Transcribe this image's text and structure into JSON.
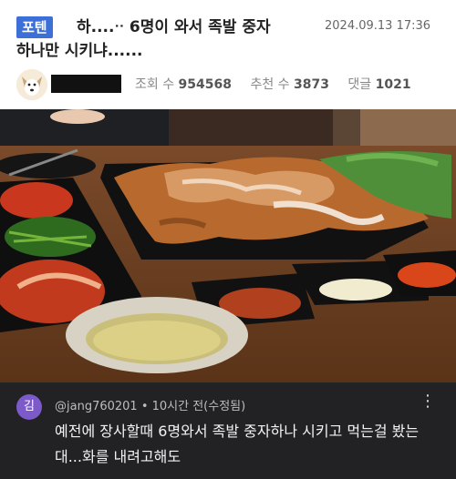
{
  "post": {
    "category_badge": "포텐",
    "title_line1": "하....ᐧᐧ 6명이 와서 족발 중자",
    "title_line2": "하나만 시키냐......",
    "date": "2024.09.13 17:36",
    "stats": {
      "views_label": "조회 수",
      "views": "954568",
      "votes_label": "추천 수",
      "votes": "3873",
      "comments_label": "댓글",
      "comments": "1021"
    }
  },
  "comment": {
    "avatar_initial": "김",
    "meta": "@jang760201 • 10시간 전(수정됨)",
    "text": "예전에 장사할때 6명와서 족발 중자하나 시키고 먹는걸 봤는대...화를 내려고해도"
  },
  "colors": {
    "badge": "#3d6fd8",
    "comment_bg": "#222225",
    "comment_avatar": "#7c5ac9"
  }
}
